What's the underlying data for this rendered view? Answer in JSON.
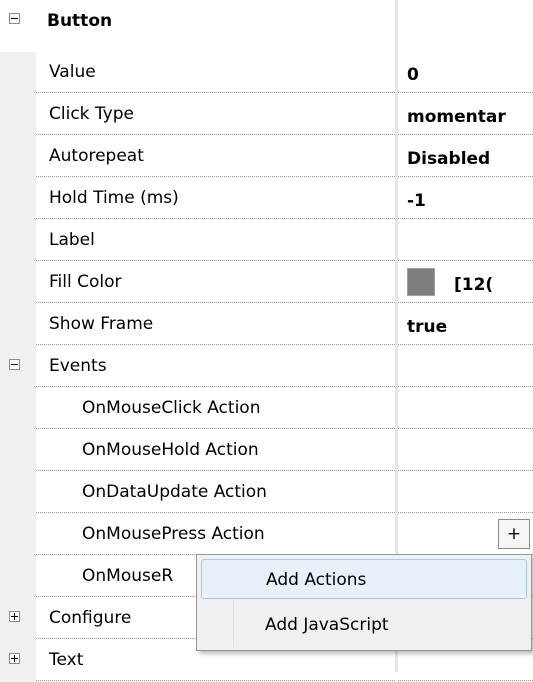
{
  "grid": {
    "category_button": "Button",
    "props": [
      {
        "name": "Value",
        "value": "0"
      },
      {
        "name": "Click Type",
        "value": "momentar"
      },
      {
        "name": "Autorepeat",
        "value": "Disabled"
      },
      {
        "name": "Hold Time (ms)",
        "value": "-1"
      },
      {
        "name": "Label",
        "value": ""
      },
      {
        "name": "Fill Color",
        "value": "[12("
      },
      {
        "name": "Show Frame",
        "value": "true"
      }
    ],
    "fill_color_swatch": "#7d7d7d",
    "events_label": "Events",
    "events": [
      "OnMouseClick Action",
      "OnMouseHold Action",
      "OnDataUpdate Action",
      "OnMousePress Action",
      "OnMouseR"
    ],
    "configure_label": "Configure",
    "text_label": "Text",
    "add_button_label": "+"
  },
  "context_menu": {
    "items": [
      "Add Actions",
      "Add JavaScript"
    ]
  }
}
